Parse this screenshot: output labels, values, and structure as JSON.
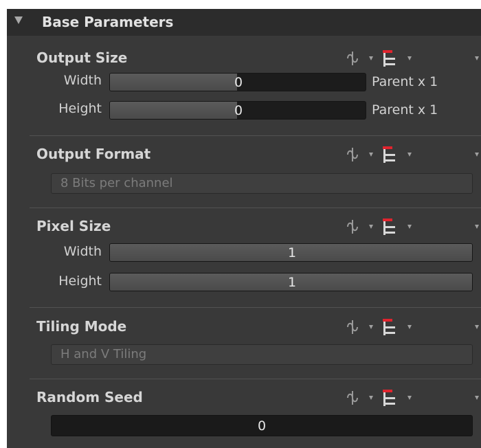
{
  "panel": {
    "title": "Base Parameters",
    "output_size": {
      "title": "Output Size",
      "width": {
        "label": "Width",
        "value": "0",
        "suffix": "Parent x 1"
      },
      "height": {
        "label": "Height",
        "value": "0",
        "suffix": "Parent x 1"
      }
    },
    "output_format": {
      "title": "Output Format",
      "value": "8 Bits per channel"
    },
    "pixel_size": {
      "title": "Pixel Size",
      "width": {
        "label": "Width",
        "value": "1"
      },
      "height": {
        "label": "Height",
        "value": "1"
      }
    },
    "tiling_mode": {
      "title": "Tiling Mode",
      "value": "H and V Tiling"
    },
    "random_seed": {
      "title": "Random Seed",
      "value": "0"
    }
  },
  "icons": {
    "function": "function-curve-icon",
    "inheritance": "inheritance-tree-icon",
    "dropdown": "chevron-down-icon"
  },
  "colors": {
    "panel_bg": "#393939",
    "header_bg": "#2c2c2c",
    "field_dark": "#1c1c1c",
    "inheritance_accent": "#e0242e"
  }
}
